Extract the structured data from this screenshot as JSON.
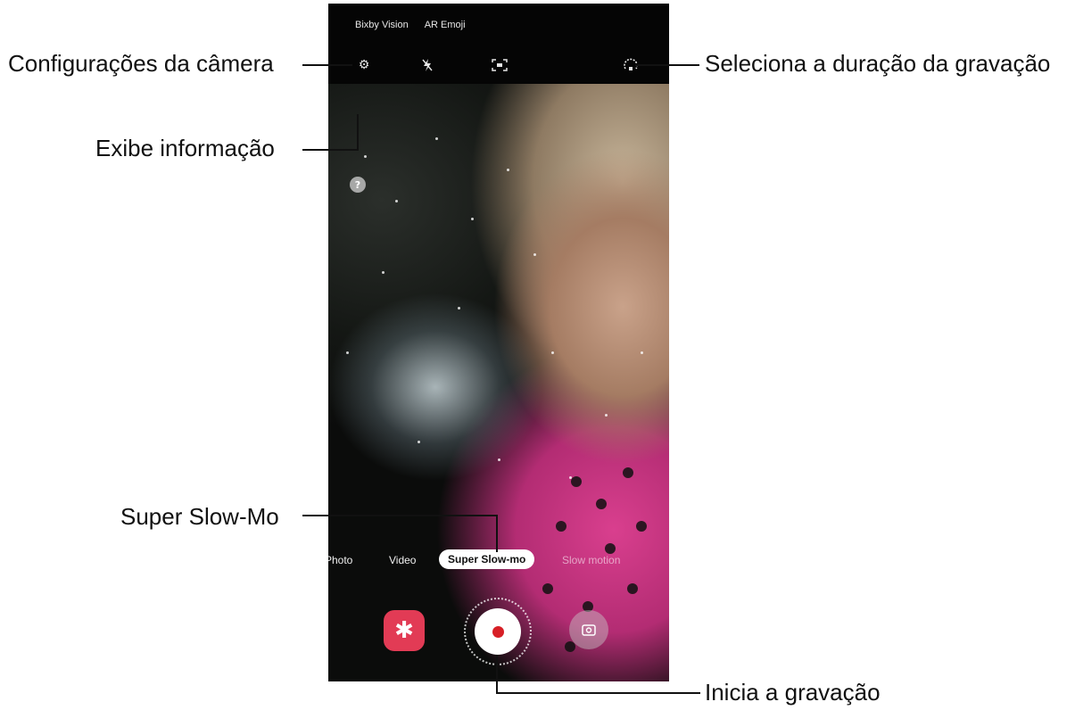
{
  "camera": {
    "top_links": [
      "Bixby Vision",
      "AR Emoji"
    ],
    "modes": {
      "photo": "Photo",
      "video": "Video",
      "super_slow": "Super Slow-mo",
      "slow_motion": "Slow motion"
    },
    "icons": {
      "settings": "gear-icon",
      "flash": "flash-off-icon",
      "motion_detect": "motion-detection-icon",
      "duration": "duration-icon",
      "info": "info-icon",
      "bixby": "bixby-icon",
      "shutter": "record-icon",
      "switch": "switch-camera-icon"
    },
    "info_glyph": "?",
    "record_color": "#d71f26",
    "bixby_color": "#e23b55"
  },
  "callouts": {
    "settings": "Configurações da câmera",
    "duration": "Seleciona a duração da gravação",
    "info": "Exibe informação",
    "super_slow": "Super Slow-Mo",
    "record": "Inicia a gravação"
  }
}
